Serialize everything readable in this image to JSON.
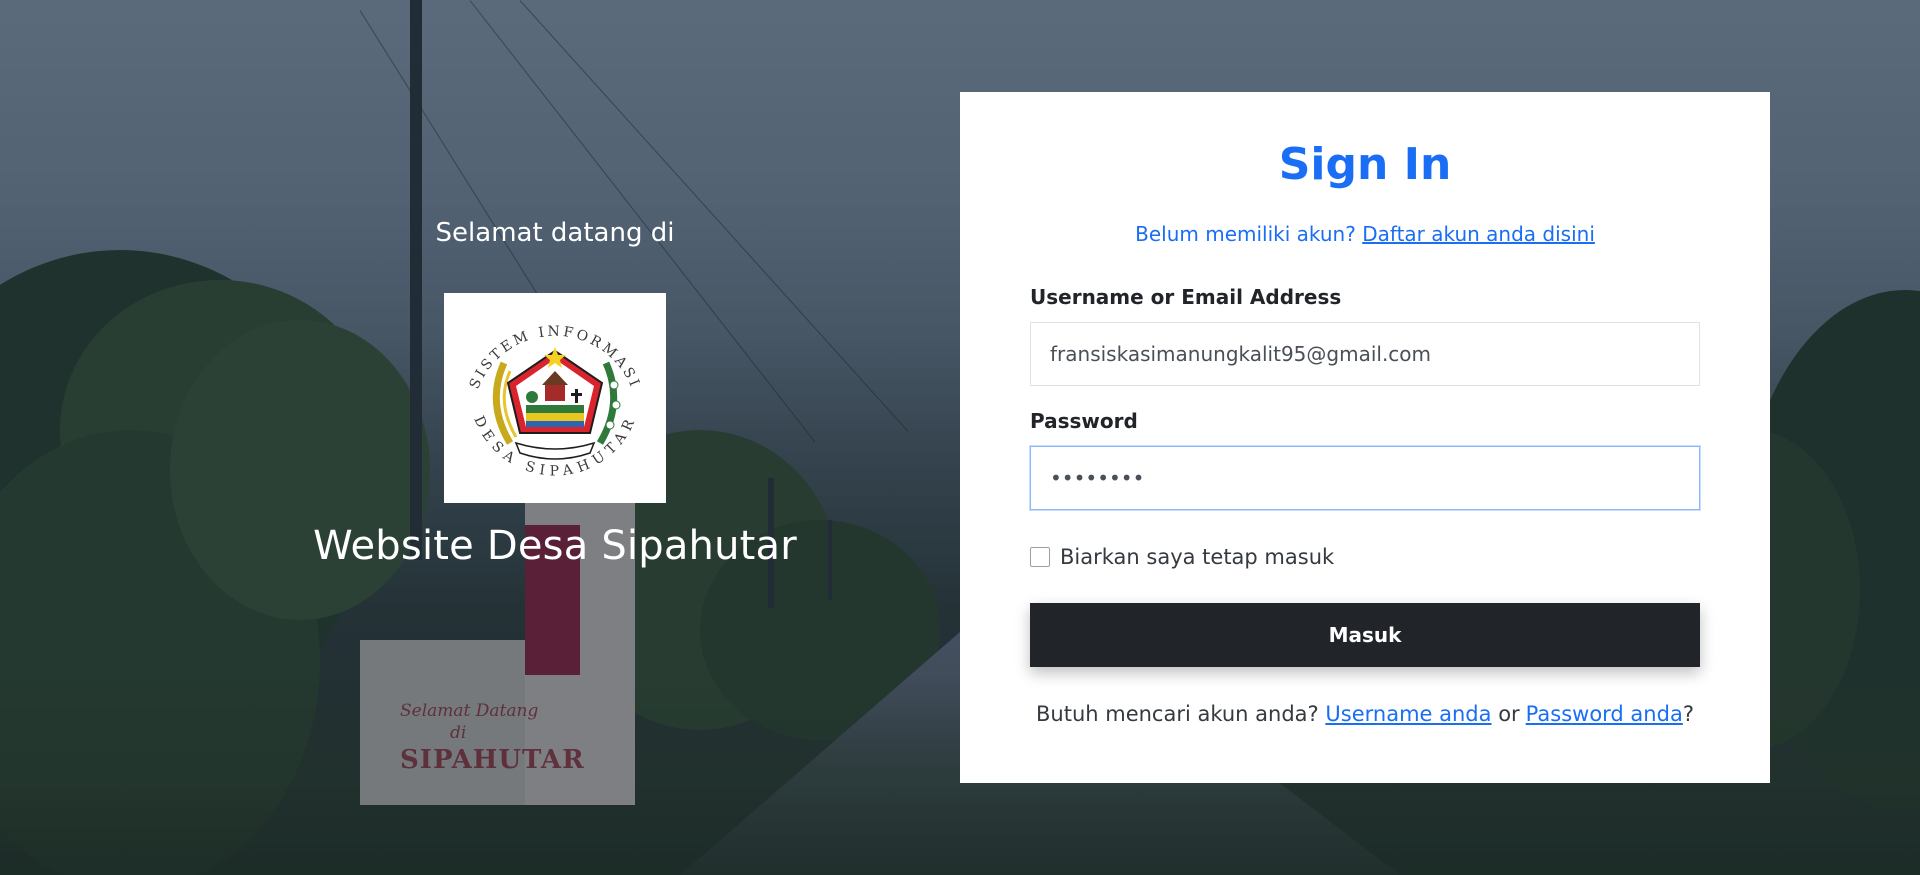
{
  "welcome": {
    "pre_title": "Selamat datang di",
    "logo": {
      "icon": "desa-sipahutar-emblem",
      "arc_top": "SISTEM INFORMASI",
      "arc_bottom": "DESA SIPAHUTAR"
    },
    "site_title": "Website Desa Sipahutar"
  },
  "background": {
    "sign_line1": "Selamat Datang",
    "sign_line2": "di",
    "sign_line3": "SIPAHUTAR"
  },
  "signin": {
    "title": "Sign In",
    "register_prompt": "Belum memiliki akun?",
    "register_link": "Daftar akun anda disini",
    "username_label": "Username or Email Address",
    "username_value": "fransiskasimanungkalit95@gmail.com",
    "password_label": "Password",
    "password_value": "••••••••",
    "remember_label": "Biarkan saya tetap masuk",
    "remember_checked": false,
    "submit_label": "Masuk",
    "help_prefix": "Butuh mencari akun anda?",
    "help_username_link": "Username anda",
    "help_or": "or",
    "help_password_link": "Password anda",
    "help_suffix": "?"
  },
  "colors": {
    "accent": "#1a6ef5",
    "button_bg": "#212529",
    "card_bg": "#ffffff"
  }
}
